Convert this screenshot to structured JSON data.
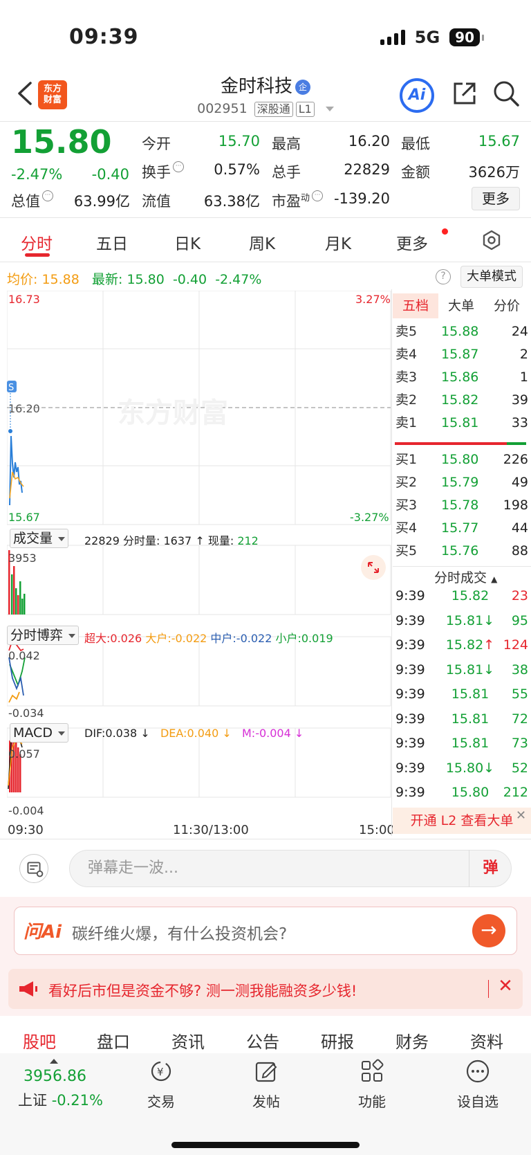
{
  "status_bar": {
    "time": "09:39",
    "network": "5G",
    "battery": "90"
  },
  "header": {
    "logo_line1": "东方",
    "logo_line2": "财富",
    "stock_name": "金时科技",
    "qi_badge": "企",
    "stock_code": "002951",
    "tag1": "深股通",
    "tag2": "L1",
    "ai_label": "Ai"
  },
  "quote": {
    "price": "15.80",
    "change_pct": "-2.47%",
    "change_val": "-0.40",
    "open_label": "今开",
    "open": "15.70",
    "high_label": "最高",
    "high": "16.20",
    "low_label": "最低",
    "low": "15.67",
    "turnover_label": "换手",
    "turnover": "0.57%",
    "volume_label": "总手",
    "volume": "22829",
    "amount_label": "金额",
    "amount": "3626万",
    "mcap_label": "总值",
    "mcap": "63.99亿",
    "float_label": "流值",
    "float_val": "63.38亿",
    "pe_label": "市盈",
    "pe_sup": "动",
    "pe": "-139.20",
    "more_label": "更多"
  },
  "chart_tabs": [
    "分时",
    "五日",
    "日K",
    "周K",
    "月K",
    "更多"
  ],
  "avg_line": {
    "avg_label": "均价:",
    "avg": "15.88",
    "latest_label": "最新:",
    "latest": "15.80",
    "chg": "-0.40",
    "chg_pct": "-2.47%",
    "help": "?",
    "bigorder_btn": "大单模式"
  },
  "main_chart": {
    "y_top": "16.73",
    "y_mid": "16.20",
    "y_bottom": "15.67",
    "pct_top": "3.27%",
    "pct_bottom": "-3.27%",
    "s_marker": "S",
    "watermark": "东方财富"
  },
  "volume_panel": {
    "select": "成交量",
    "total": "22829",
    "minute_label": "分时量:",
    "minute": "1637",
    "arrow": "↑",
    "now_label": "现量:",
    "now": "212",
    "y_top": "3953"
  },
  "game_panel": {
    "select": "分时博弈",
    "super_label": "超大:",
    "super": "0.026",
    "big_label": "大户:",
    "big": "-0.022",
    "mid_label": "中户:",
    "mid": "-0.022",
    "small_label": "小户:",
    "small": "0.019",
    "y_top": "0.042",
    "y_bottom": "-0.034"
  },
  "macd_panel": {
    "select": "MACD",
    "dif": "DIF:0.038 ↓",
    "dea": "DEA:0.040 ↓",
    "m": "M:-0.004 ↓",
    "y_top": "0.057",
    "y_bottom": "-0.004"
  },
  "time_axis": [
    "09:30",
    "11:30/13:00",
    "15:00"
  ],
  "right_panel": {
    "tabs": [
      "五档",
      "大单",
      "分价"
    ],
    "asks": [
      {
        "label": "卖5",
        "price": "15.88",
        "vol": "24"
      },
      {
        "label": "卖4",
        "price": "15.87",
        "vol": "2"
      },
      {
        "label": "卖3",
        "price": "15.86",
        "vol": "1"
      },
      {
        "label": "卖2",
        "price": "15.82",
        "vol": "39"
      },
      {
        "label": "卖1",
        "price": "15.81",
        "vol": "33"
      }
    ],
    "bids": [
      {
        "label": "买1",
        "price": "15.80",
        "vol": "226"
      },
      {
        "label": "买2",
        "price": "15.79",
        "vol": "49"
      },
      {
        "label": "买3",
        "price": "15.78",
        "vol": "198"
      },
      {
        "label": "买4",
        "price": "15.77",
        "vol": "44"
      },
      {
        "label": "买5",
        "price": "15.76",
        "vol": "88"
      }
    ],
    "ticks_title": "分时成交",
    "ticks": [
      {
        "time": "9:39",
        "price": "15.82",
        "vol": "23",
        "color": "#e6262e"
      },
      {
        "time": "9:39",
        "price": "15.81↓",
        "vol": "95",
        "color": "#13a035"
      },
      {
        "time": "9:39",
        "price": "15.82↑",
        "vol": "124",
        "color": "#e6262e"
      },
      {
        "time": "9:39",
        "price": "15.81↓",
        "vol": "38",
        "color": "#13a035"
      },
      {
        "time": "9:39",
        "price": "15.81",
        "vol": "55",
        "color": "#13a035"
      },
      {
        "time": "9:39",
        "price": "15.81",
        "vol": "72",
        "color": "#13a035"
      },
      {
        "time": "9:39",
        "price": "15.81",
        "vol": "73",
        "color": "#13a035"
      },
      {
        "time": "9:39",
        "price": "15.80↓",
        "vol": "52",
        "color": "#13a035"
      },
      {
        "time": "9:39",
        "price": "15.80",
        "vol": "212",
        "color": "#13a035"
      }
    ],
    "l2_banner": "开通 L2 查看大单"
  },
  "comment_bar": {
    "placeholder": "弹幕走一波...",
    "danmu_btn": "弹"
  },
  "ask_ai": {
    "logo": "问Ai",
    "text": "碳纤维火爆，有什么投资机会?"
  },
  "promo": {
    "text": "看好后市但是资金不够? 测一测我能融资多少钱!"
  },
  "bottom_tabs": [
    "股吧",
    "盘口",
    "资讯",
    "公告",
    "研报",
    "财务",
    "资料"
  ],
  "footer": {
    "index_value": "3956.86",
    "index_name": "上证",
    "index_chg": "-0.21%",
    "buttons": [
      "交易",
      "发帖",
      "功能",
      "设自选"
    ]
  }
}
